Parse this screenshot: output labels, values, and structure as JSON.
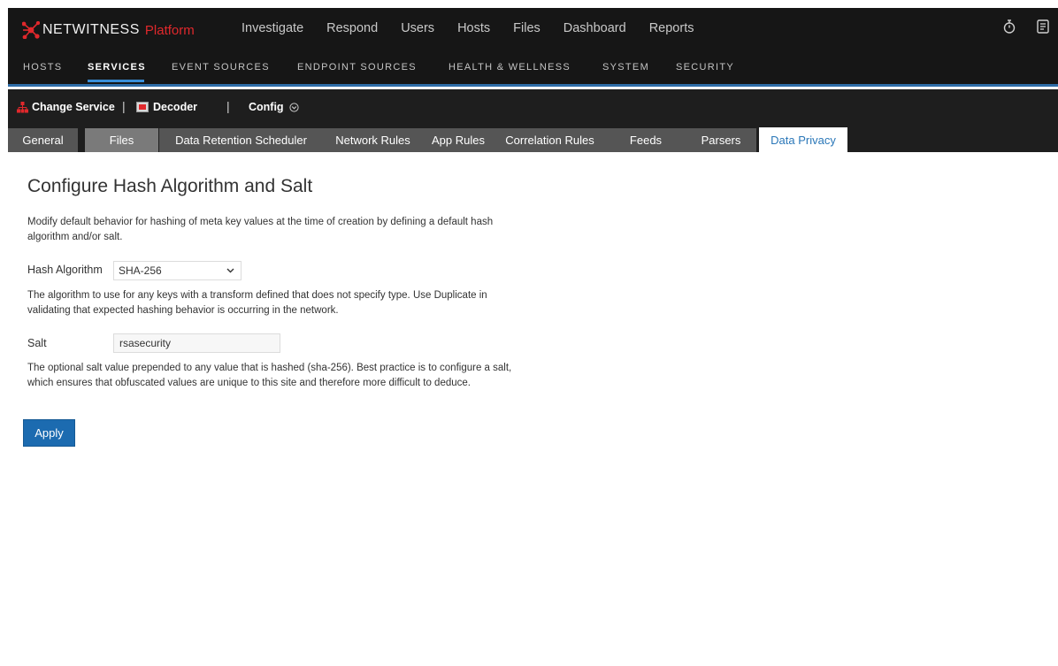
{
  "brand": {
    "name": "NETWITNESS",
    "product": "Platform",
    "logo_color": "#e0282c"
  },
  "main_nav": [
    "Investigate",
    "Respond",
    "Users",
    "Hosts",
    "Files",
    "Dashboard",
    "Reports"
  ],
  "top_icons": [
    "timer-icon",
    "notes-icon"
  ],
  "admin_nav": {
    "items": [
      "HOSTS",
      "SERVICES",
      "EVENT SOURCES",
      "ENDPOINT SOURCES",
      "HEALTH & WELLNESS",
      "SYSTEM",
      "SECURITY"
    ],
    "active": "SERVICES",
    "accent": "#3a8fd8"
  },
  "service_bar": {
    "change_service": "Change Service",
    "service_name": "Decoder",
    "view": "Config",
    "separator": "|"
  },
  "tabs": {
    "items": [
      "General",
      "Files",
      "Data Retention Scheduler",
      "Network Rules",
      "App Rules",
      "Correlation Rules",
      "Feeds",
      "Parsers",
      "Data Privacy"
    ],
    "active": "Data Privacy"
  },
  "content": {
    "title": "Configure Hash Algorithm and Salt",
    "intro": "Modify default behavior for hashing of meta key values at the time of creation by defining a default hash algorithm and/or salt.",
    "hash_label": "Hash Algorithm",
    "hash_value": "SHA-256",
    "hash_help": "The algorithm to use for any keys with a transform defined that does not specify type. Use Duplicate in validating that expected hashing behavior is occurring in the network.",
    "salt_label": "Salt",
    "salt_value": "rsasecurity",
    "salt_help": "The optional salt value prepended to any value that is hashed (sha-256). Best practice is to configure a salt, which ensures that obfuscated values are unique to this site and therefore more difficult to deduce.",
    "apply_label": "Apply"
  }
}
